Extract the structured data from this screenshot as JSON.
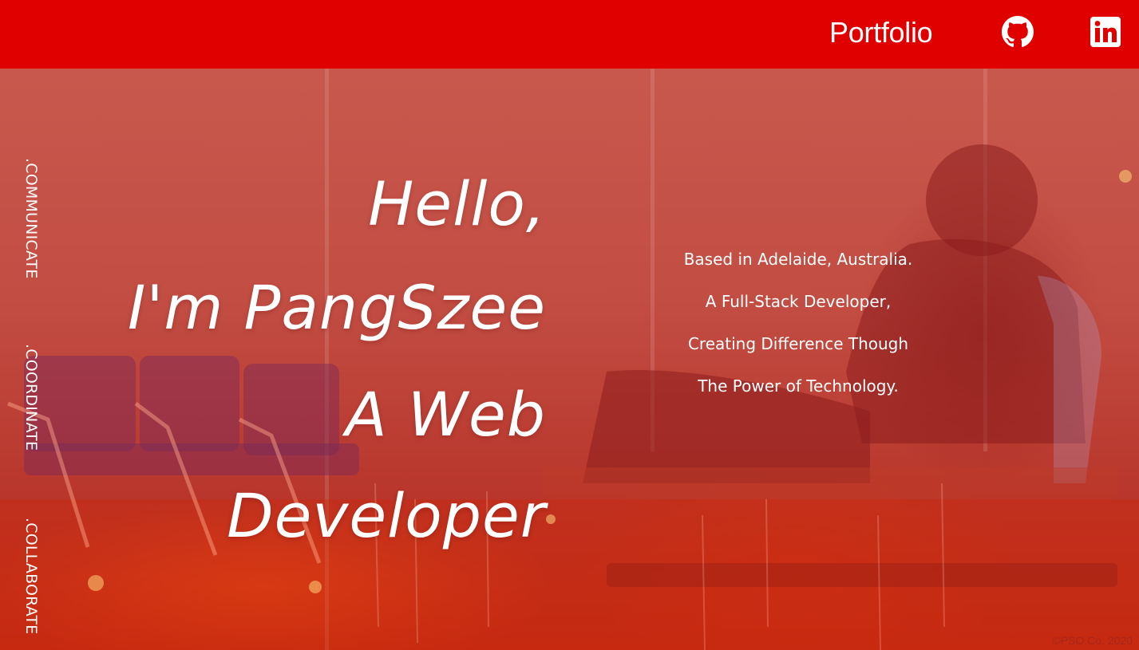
{
  "header": {
    "nav_link": "Portfolio",
    "github_icon": "github-icon",
    "linkedin_icon": "linkedin-icon"
  },
  "side_words": [
    ".COMMUNICATE",
    ".COORDINATE",
    ".COLLABORATE"
  ],
  "headline": [
    "Hello,",
    "I'm PangSzee",
    "A Web",
    "Developer"
  ],
  "about": [
    "Based in Adelaide, Australia.",
    "A Full-Stack Developer,",
    "Creating Difference Though",
    "The Power of Technology."
  ],
  "footer": {
    "copyright": "©PSO Co. 2020"
  },
  "colors": {
    "header_bg": "#e10000",
    "text": "#ffffff",
    "hero_tint": "#c8584d"
  }
}
